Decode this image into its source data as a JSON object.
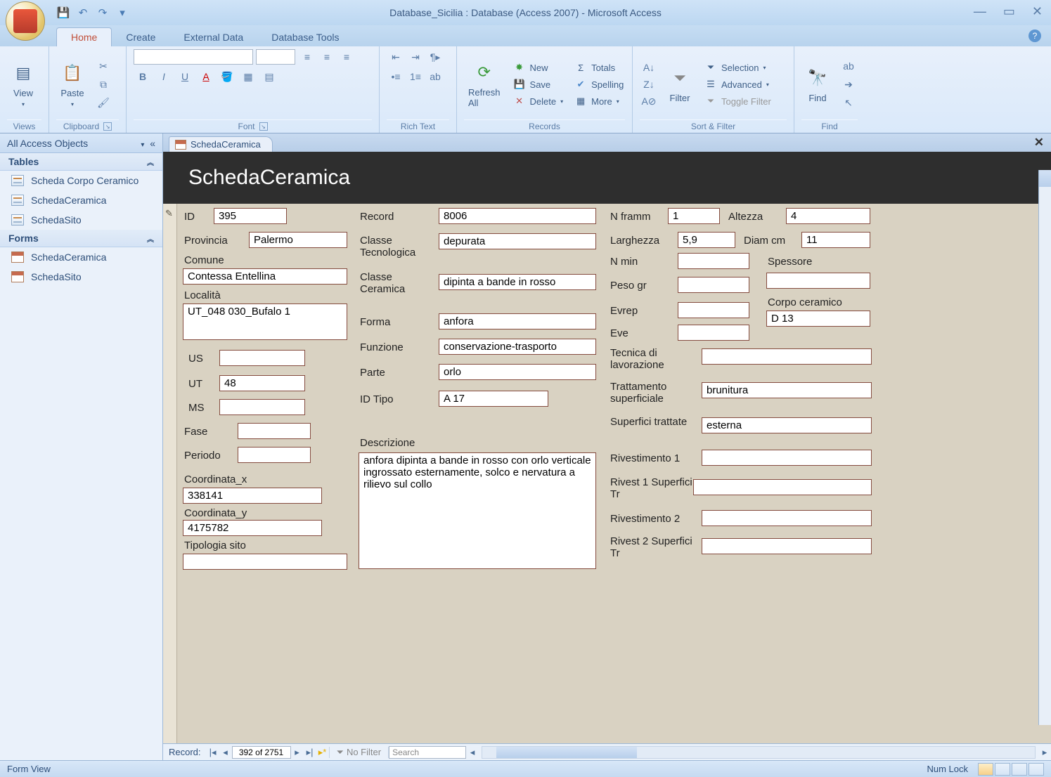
{
  "titlebar": {
    "title": "Database_Sicilia : Database (Access 2007) - Microsoft Access"
  },
  "tabs": {
    "home": "Home",
    "create": "Create",
    "external": "External Data",
    "tools": "Database Tools"
  },
  "ribbon": {
    "views": {
      "label": "Views",
      "view": "View"
    },
    "clipboard": {
      "label": "Clipboard",
      "paste": "Paste"
    },
    "font": {
      "label": "Font"
    },
    "richtext": {
      "label": "Rich Text"
    },
    "records": {
      "label": "Records",
      "refresh": "Refresh All",
      "new": "New",
      "save": "Save",
      "delete": "Delete",
      "totals": "Totals",
      "spelling": "Spelling",
      "more": "More"
    },
    "sortfilter": {
      "label": "Sort & Filter",
      "filter": "Filter",
      "selection": "Selection",
      "advanced": "Advanced",
      "toggle": "Toggle Filter"
    },
    "find": {
      "label": "Find",
      "find": "Find"
    }
  },
  "nav": {
    "header": "All Access Objects",
    "tables_label": "Tables",
    "forms_label": "Forms",
    "tables": [
      "Scheda Corpo Ceramico",
      "SchedaCeramica",
      "SchedaSito"
    ],
    "forms": [
      "SchedaCeramica",
      "SchedaSito"
    ]
  },
  "doc": {
    "tab": "SchedaCeramica",
    "title": "SchedaCeramica"
  },
  "form": {
    "labels": {
      "id": "ID",
      "record": "Record",
      "nframm": "N framm",
      "altezza": "Altezza",
      "provincia": "Provincia",
      "classe_tecn": "Classe Tecnologica",
      "larghezza": "Larghezza",
      "diam": "Diam cm",
      "comune": "Comune",
      "classe_cer": "Classe Ceramica",
      "nmin": "N min",
      "spessore": "Spessore",
      "localita": "Località",
      "forma": "Forma",
      "peso": "Peso gr",
      "corpo": "Corpo ceramico",
      "funzione": "Funzione",
      "evrep": "Evrep",
      "eve": "Eve",
      "parte": "Parte",
      "tecnica": "Tecnica di lavorazione",
      "id_tipo": "ID Tipo",
      "tratt_sup": "Trattamento superficiale",
      "us": "US",
      "ut": "UT",
      "ms": "MS",
      "fase": "Fase",
      "periodo": "Periodo",
      "sup_tratt": "Superfici trattate",
      "riv1": "Rivestimento 1",
      "riv1st": "Rivest 1 Superfici Tr",
      "riv2": "Rivestimento 2",
      "riv2st": "Rivest 2 Superfici Tr",
      "descr": "Descrizione",
      "coord_x": "Coordinata_x",
      "coord_y": "Coordinata_y",
      "tip_sito": "Tipologia sito"
    },
    "values": {
      "id": "395",
      "record": "8006",
      "nframm": "1",
      "altezza": "4",
      "provincia": "Palermo",
      "classe_tecn": "depurata",
      "larghezza": "5,9",
      "diam": "11",
      "comune": "Contessa Entellina",
      "classe_cer": "dipinta a bande in rosso",
      "localita": "UT_048 030_Bufalo 1",
      "forma": "anfora",
      "corpo": "D 13",
      "funzione": "conservazione-trasporto",
      "parte": "orlo",
      "id_tipo": "A 17",
      "ut": "48",
      "tratt_sup": "brunitura",
      "sup_tratt": "esterna",
      "descr": "anfora dipinta a bande in rosso con orlo verticale ingrossato esternamente, solco e nervatura a rilievo sul collo",
      "coord_x": "338141",
      "coord_y": "4175782"
    }
  },
  "recordnav": {
    "label": "Record:",
    "position": "392 of 2751",
    "filter": "No Filter",
    "search": "Search"
  },
  "status": {
    "mode": "Form View",
    "numlock": "Num Lock"
  }
}
